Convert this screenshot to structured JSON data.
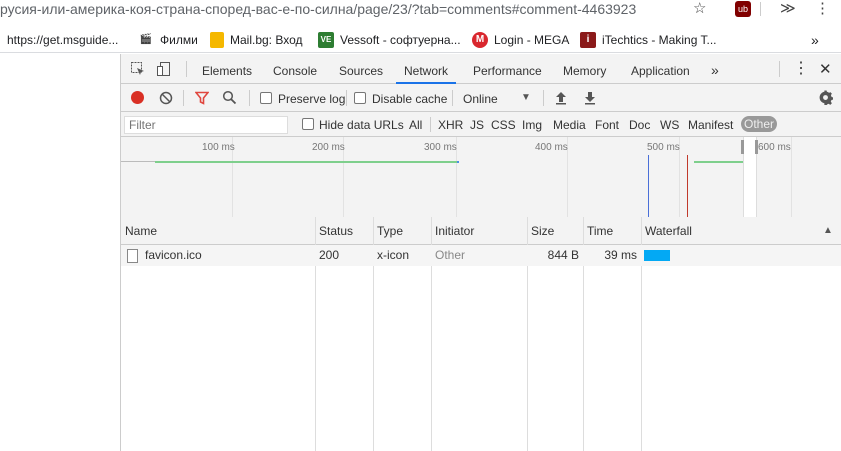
{
  "browser": {
    "url": "русия-или-америка-коя-страна-според-вас-е-по-силна/page/23/?tab=comments#comment-4463923",
    "bookmarks": [
      {
        "label": "https://get.msguide...",
        "icon": "grid-icon"
      },
      {
        "label": "Филми",
        "icon": "clapper-icon"
      },
      {
        "label": "Mail.bg: Вход",
        "icon": "mailbg-icon"
      },
      {
        "label": "Vessoft - софтуерна...",
        "icon": "vessoft-icon"
      },
      {
        "label": "Login - MEGA",
        "icon": "mega-icon"
      },
      {
        "label": "iTechtics - Making T...",
        "icon": "itechtics-icon"
      }
    ],
    "overflow": "»"
  },
  "devtools": {
    "tabs": [
      "Elements",
      "Console",
      "Sources",
      "Network",
      "Performance",
      "Memory",
      "Application"
    ],
    "active_tab": "Network",
    "more_tabs": "»",
    "toolbar": {
      "preserve_log": "Preserve log",
      "disable_cache": "Disable cache",
      "throttling": "Online"
    },
    "filter": {
      "placeholder": "Filter",
      "hide_data_urls": "Hide data URLs",
      "types": [
        "All",
        "XHR",
        "JS",
        "CSS",
        "Img",
        "Media",
        "Font",
        "Doc",
        "WS",
        "Manifest",
        "Other"
      ],
      "selected_type": "Other"
    },
    "overview": {
      "ticks": [
        "100 ms",
        "200 ms",
        "300 ms",
        "400 ms",
        "500 ms",
        "600 ms"
      ]
    },
    "table": {
      "columns": [
        "Name",
        "Status",
        "Type",
        "Initiator",
        "Size",
        "Time",
        "Waterfall"
      ],
      "rows": [
        {
          "name": "favicon.ico",
          "status": "200",
          "type": "x-icon",
          "initiator": "Other",
          "size": "844 B",
          "time": "39 ms"
        }
      ]
    }
  },
  "colors": {
    "accent": "#1a73e8",
    "record": "#d93025",
    "filter_icon": "#e0463e",
    "waterfall_bar": "#03a9f4"
  }
}
